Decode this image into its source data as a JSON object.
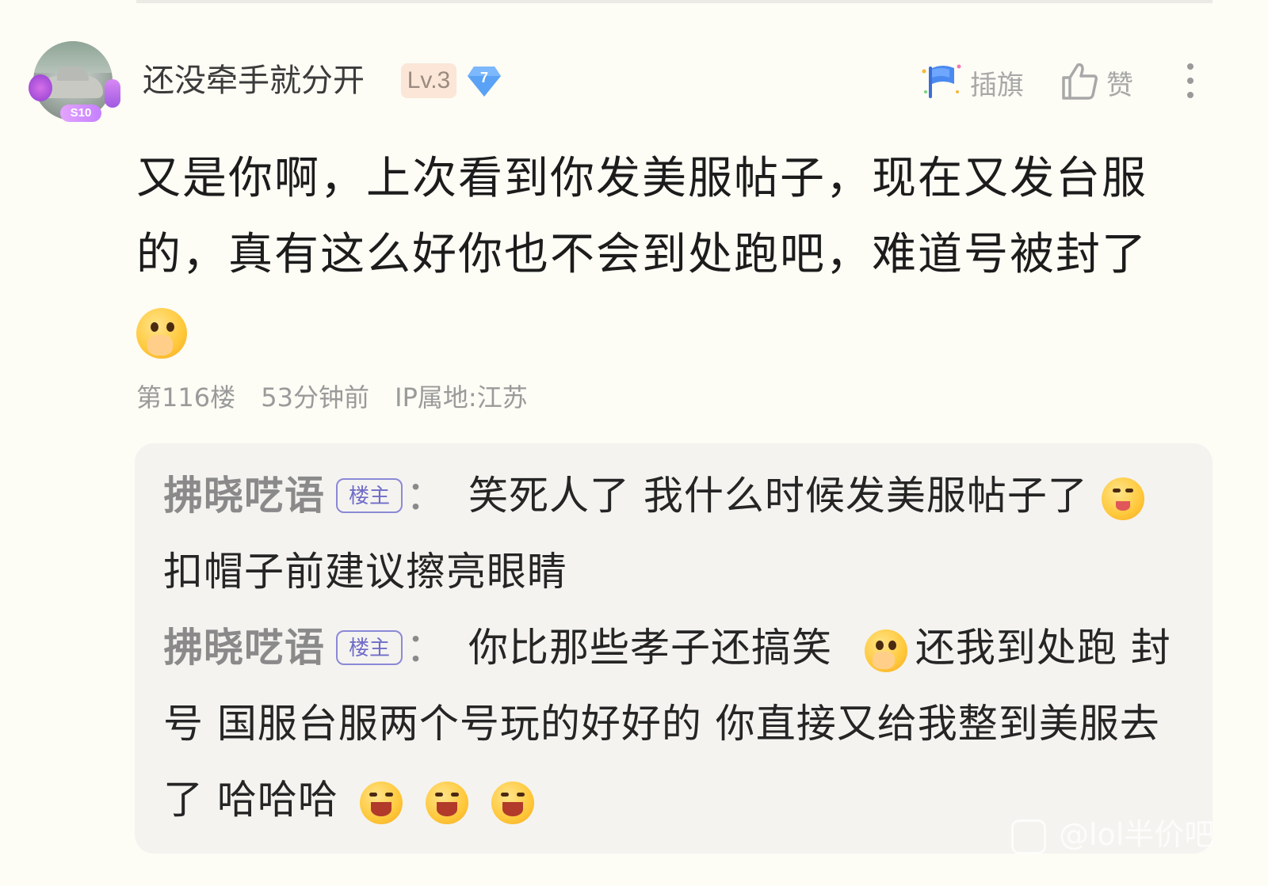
{
  "post": {
    "user": {
      "name": "还没牵手就分开",
      "level": "Lv.3",
      "diamond_level": "7",
      "avatar_badge": "S10"
    },
    "actions": {
      "flag_label": "插旗",
      "like_label": "赞"
    },
    "comment": {
      "text": "又是你啊，上次看到你发美服帖子，现在又发台服的，真有这么好你也不会到处跑吧，难道号被封了"
    },
    "meta": {
      "floor": "第116楼",
      "time": "53分钟前",
      "ip": "IP属地:江苏"
    }
  },
  "replies": [
    {
      "author": "拂晓呓语",
      "tag": "楼主",
      "colon": "：",
      "text_a": "笑死人了 我什么时候发美服帖子了",
      "text_b": "扣帽子前建议擦亮眼睛"
    },
    {
      "author": "拂晓呓语",
      "tag": "楼主",
      "colon": "：",
      "text_a": "你比那些孝子还搞笑",
      "text_b": "还我到处跑 封号 国服台服两个号玩的好好的 你直接又给我整到美服去了 哈哈哈"
    }
  ],
  "watermark": {
    "text": "@lol半价吧"
  },
  "icons": [
    "flag-icon",
    "thumbs-up-icon",
    "more-icon",
    "diamond-icon"
  ]
}
